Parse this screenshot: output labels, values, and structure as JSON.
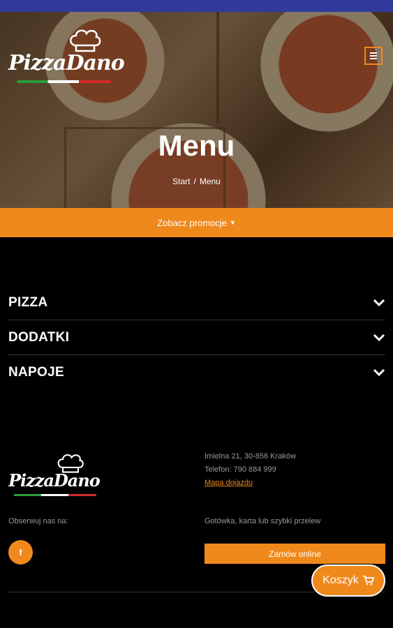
{
  "header": {
    "logo_text": "PizzaDano",
    "menu_icon": "hamburger-icon",
    "title": "Menu",
    "breadcrumb": {
      "home": "Start",
      "separator": "/",
      "current": "Menu"
    }
  },
  "promo": {
    "label": "Zobacz promocje",
    "icon": "caret-down-icon"
  },
  "categories": [
    {
      "label": "PIZZA"
    },
    {
      "label": "DODATKI"
    },
    {
      "label": "NAPOJE"
    }
  ],
  "footer": {
    "logo_text": "PizzaDano",
    "address": "Imielna 21, 30-856 Kraków",
    "phone": "Telefon: 790 884 999",
    "map_link": "Mapa dojazdu",
    "follow_label": "Obserwuj nas na:",
    "facebook_icon_text": "f",
    "payment_info": "Gotówka, karta lub szybki przelew",
    "order_button": "Zamów online"
  },
  "cart": {
    "label": "Koszyk",
    "icon": "cart-icon"
  },
  "colors": {
    "accent": "#f0891c",
    "status_bar": "#2f3a9c",
    "background": "#000000"
  }
}
